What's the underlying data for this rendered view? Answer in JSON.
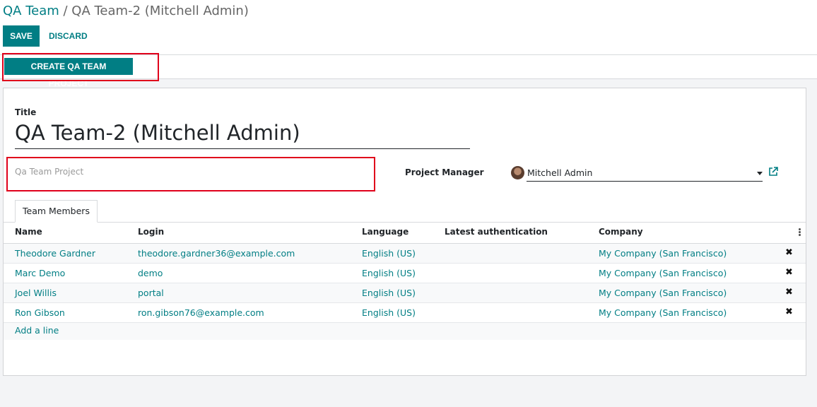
{
  "breadcrumb": {
    "parent": "QA Team",
    "separator": " / ",
    "current": "QA Team-2 (Mitchell Admin)"
  },
  "toolbar": {
    "save": "Save",
    "discard": "Discard"
  },
  "statusbar": {
    "create_button": "Create QA Team Project"
  },
  "form": {
    "title_label": "Title",
    "title_value": "QA Team-2 (Mitchell Admin)",
    "project_placeholder": "Qa Team Project",
    "project_manager_label": "Project Manager",
    "project_manager_value": "Mitchell Admin"
  },
  "tabs": [
    {
      "label": "Team Members"
    }
  ],
  "table": {
    "columns": [
      "Name",
      "Login",
      "Language",
      "Latest authentication",
      "Company"
    ],
    "rows": [
      {
        "name": "Theodore Gardner",
        "login": "theodore.gardner36@example.com",
        "language": "English (US)",
        "auth": "",
        "company": "My Company (San Francisco)"
      },
      {
        "name": "Marc Demo",
        "login": "demo",
        "language": "English (US)",
        "auth": "",
        "company": "My Company (San Francisco)"
      },
      {
        "name": "Joel Willis",
        "login": "portal",
        "language": "English (US)",
        "auth": "",
        "company": "My Company (San Francisco)"
      },
      {
        "name": "Ron Gibson",
        "login": "ron.gibson76@example.com",
        "language": "English (US)",
        "auth": "",
        "company": "My Company (San Francisco)"
      }
    ],
    "add_line": "Add a line",
    "delete_icon": "✖"
  },
  "colors": {
    "accent": "#017e84",
    "highlight": "#e0001b"
  }
}
